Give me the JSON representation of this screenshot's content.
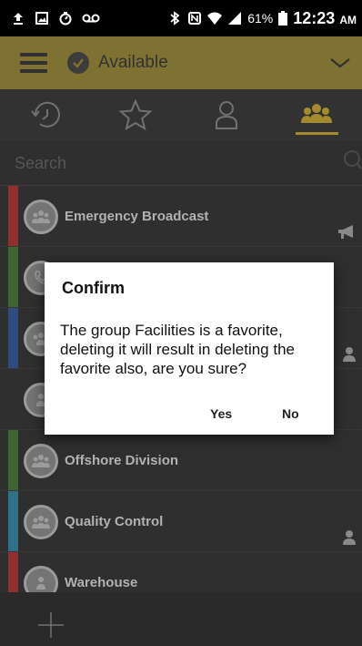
{
  "status_bar": {
    "battery_percent": "61%",
    "time": "12:23",
    "ampm": "AM",
    "icons": [
      "upload-icon",
      "image-icon",
      "stopwatch-icon",
      "voicemail-icon",
      "bluetooth-icon",
      "nfc-icon",
      "wifi-icon",
      "signal-icon",
      "battery-icon"
    ]
  },
  "header": {
    "presence_status": "Available",
    "accent_color": "#9c8a3c"
  },
  "tabs": [
    {
      "icon": "history-icon",
      "active": false
    },
    {
      "icon": "star-icon",
      "active": false
    },
    {
      "icon": "contact-icon",
      "active": false
    },
    {
      "icon": "groups-icon",
      "active": true
    }
  ],
  "search": {
    "placeholder": "Search"
  },
  "list": {
    "items": [
      {
        "label": "Emergency Broadcast",
        "accent": "#b23a3a",
        "side_icon": "megaphone-icon"
      },
      {
        "label": "",
        "accent": "#4d7a3c",
        "side_icon": ""
      },
      {
        "label": "",
        "accent": "#3a5c9c",
        "side_icon": "person-icon"
      },
      {
        "label": "",
        "accent": "",
        "side_icon": ""
      },
      {
        "label": "Offshore Division",
        "accent": "#4d7a3c",
        "side_icon": ""
      },
      {
        "label": "Quality Control",
        "accent": "#3a8aa8",
        "side_icon": "person-icon"
      },
      {
        "label": "Warehouse",
        "accent": "#b23a3a",
        "side_icon": ""
      }
    ]
  },
  "dialog": {
    "title": "Confirm",
    "message": "The group Facilities is a favorite, deleting it will result in deleting the favorite also, are you sure?",
    "yes_label": "Yes",
    "no_label": "No"
  }
}
